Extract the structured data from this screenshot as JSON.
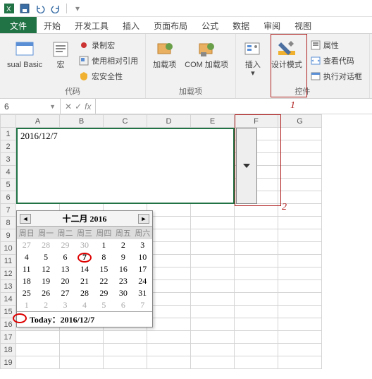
{
  "qat": {
    "items": [
      "save",
      "undo",
      "redo"
    ]
  },
  "tabs": {
    "file": "文件",
    "list": [
      "开始",
      "开发工具",
      "插入",
      "页面布局",
      "公式",
      "数据",
      "审阅",
      "视图"
    ]
  },
  "ribbon": {
    "group1": {
      "label": "代码",
      "vb": "sual Basic",
      "macro": "宏",
      "record": "录制宏",
      "relref": "使用相对引用",
      "security": "宏安全性"
    },
    "group2": {
      "label": "加载项",
      "addins": "加载项",
      "com": "COM 加载项"
    },
    "group3": {
      "label": "控件",
      "insert": "插入",
      "design": "设计模式",
      "props": "属性",
      "viewcode": "查看代码",
      "rundlg": "执行对话框"
    }
  },
  "callouts": {
    "num1": "1",
    "num2": "2"
  },
  "formula": {
    "name": "6",
    "fx": "fx"
  },
  "columns": [
    "A",
    "B",
    "C",
    "D",
    "E",
    "F",
    "G"
  ],
  "rows_start": 1,
  "rows_end": 19,
  "cell_value": "2016/12/7",
  "calendar": {
    "title": "十二月 2016",
    "dow": [
      "周日",
      "周一",
      "周二",
      "周三",
      "周四",
      "周五",
      "周六"
    ],
    "weeks": [
      [
        {
          "d": 27,
          "dim": true
        },
        {
          "d": 28,
          "dim": true
        },
        {
          "d": 29,
          "dim": true
        },
        {
          "d": 30,
          "dim": true
        },
        {
          "d": 1
        },
        {
          "d": 2
        },
        {
          "d": 3
        }
      ],
      [
        {
          "d": 4
        },
        {
          "d": 5
        },
        {
          "d": 6
        },
        {
          "d": 7,
          "circ": true
        },
        {
          "d": 8
        },
        {
          "d": 9
        },
        {
          "d": 10
        }
      ],
      [
        {
          "d": 11
        },
        {
          "d": 12
        },
        {
          "d": 13
        },
        {
          "d": 14
        },
        {
          "d": 15
        },
        {
          "d": 16
        },
        {
          "d": 17
        }
      ],
      [
        {
          "d": 18
        },
        {
          "d": 19
        },
        {
          "d": 20
        },
        {
          "d": 21
        },
        {
          "d": 22
        },
        {
          "d": 23
        },
        {
          "d": 24
        }
      ],
      [
        {
          "d": 25
        },
        {
          "d": 26
        },
        {
          "d": 27
        },
        {
          "d": 28
        },
        {
          "d": 29
        },
        {
          "d": 30
        },
        {
          "d": 31
        }
      ],
      [
        {
          "d": 1,
          "dim": true
        },
        {
          "d": 2,
          "dim": true
        },
        {
          "d": 3,
          "dim": true
        },
        {
          "d": 4,
          "dim": true
        },
        {
          "d": 5,
          "dim": true
        },
        {
          "d": 6,
          "dim": true
        },
        {
          "d": 7,
          "dim": true
        }
      ]
    ],
    "today_label": "Today：2016/12/7"
  }
}
